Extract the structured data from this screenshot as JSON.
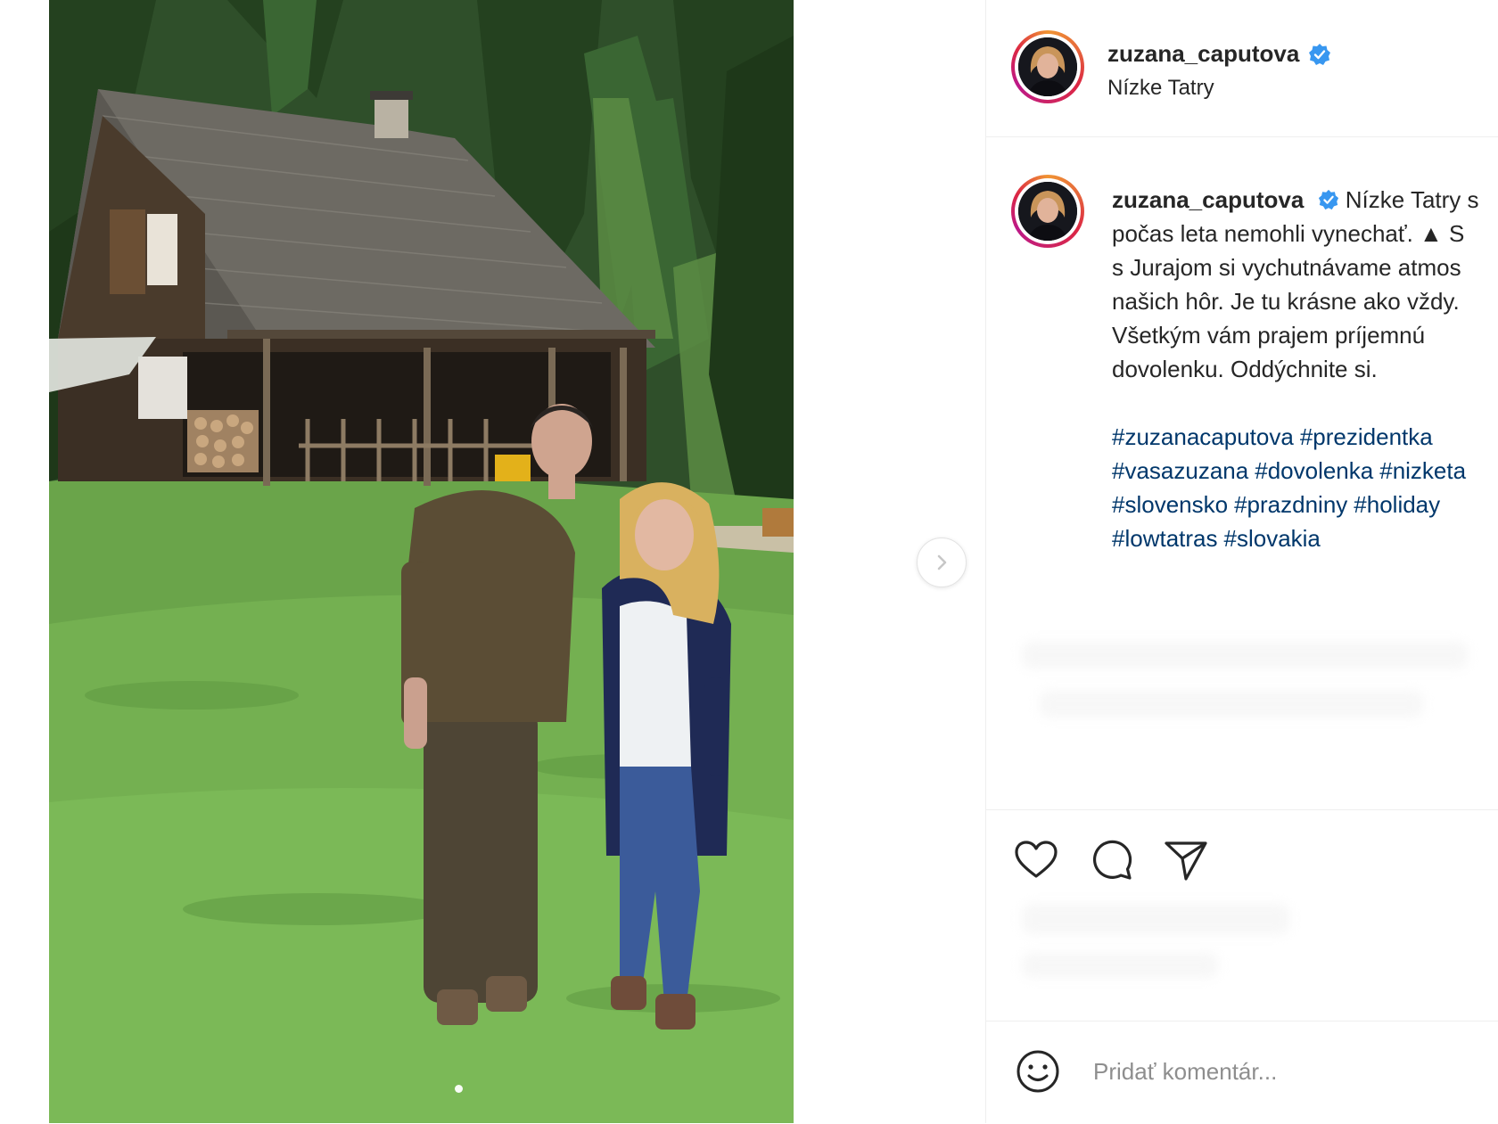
{
  "post": {
    "username": "zuzana_caputova",
    "location": "Nízke Tatry",
    "verified": true
  },
  "caption": {
    "username": "zuzana_caputova",
    "lines": [
      " Nízke Tatry s",
      "počas leta nemohli vynechať. ▲ S",
      "s Jurajom si vychutnávame atmos",
      "našich hôr. Je tu krásne ako vždy.",
      "Všetkým vám prajem príjemnú",
      "dovolenku. Oddýchnite si."
    ],
    "hashtag_lines": [
      [
        "#zuzanacaputova",
        "#prezidentka"
      ],
      [
        "#vasazuzana",
        "#dovolenka",
        "#nizketa"
      ],
      [
        "#slovensko",
        "#prazdniny",
        "#holiday"
      ],
      [
        "#lowtatras",
        "#slovakia"
      ]
    ]
  },
  "comment_box": {
    "placeholder": "Pridať komentár..."
  },
  "icons": {
    "like": "heart-icon",
    "comment": "comment-icon",
    "share": "paper-plane-icon",
    "emoji": "smiley-icon",
    "next": "chevron-right-icon",
    "verified": "verified-badge-icon"
  },
  "colors": {
    "text": "#262626",
    "hashtag": "#00376b",
    "verified": "#3897f0",
    "placeholder": "#8e8e8e"
  }
}
